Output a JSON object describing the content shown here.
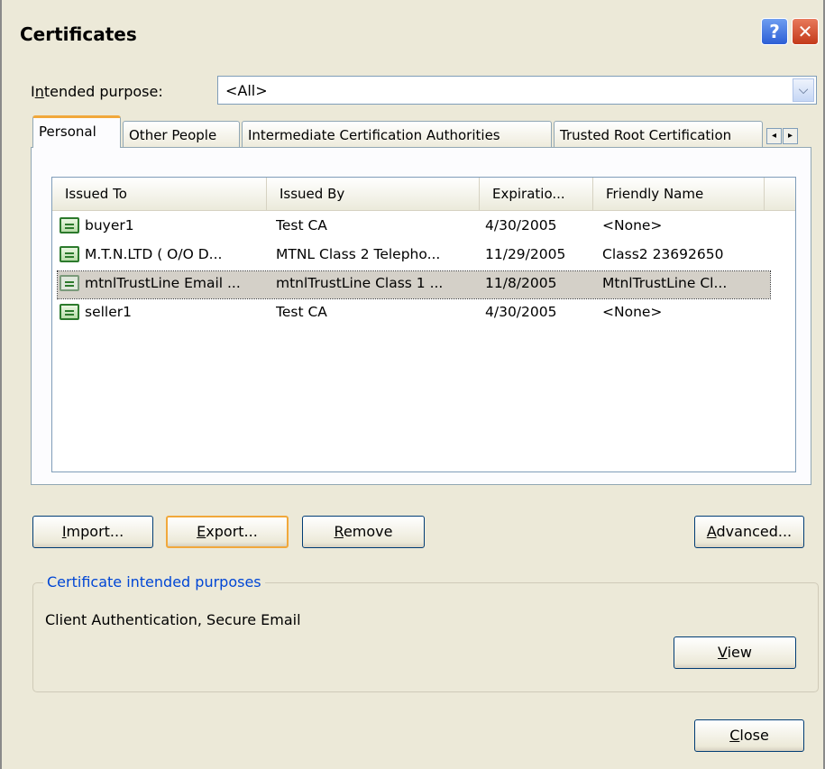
{
  "window": {
    "title": "Certificates",
    "help_glyph": "?",
    "close_glyph": "✕"
  },
  "intended_purpose": {
    "label_prefix": "I",
    "label_accel": "n",
    "label_rest": "tended purpose:",
    "value": "<All>",
    "arrow_icon": "chevron-down-icon"
  },
  "tabs": [
    {
      "label": "Personal",
      "active": true
    },
    {
      "label": "Other People",
      "active": false
    },
    {
      "label": "Intermediate Certification Authorities",
      "active": false
    },
    {
      "label": "Trusted Root Certification",
      "active": false
    }
  ],
  "tab_scroll": {
    "left": "◂",
    "right": "▸"
  },
  "list": {
    "columns": [
      "Issued To",
      "Issued By",
      "Expiratio...",
      "Friendly Name"
    ],
    "rows": [
      {
        "issued_to": "buyer1",
        "issued_by": "Test CA",
        "expiration": "4/30/2005",
        "friendly_name": "<None>",
        "selected": false
      },
      {
        "issued_to": "M.T.N.LTD ( O/O D...",
        "issued_by": "MTNL Class 2 Telepho...",
        "expiration": "11/29/2005",
        "friendly_name": "Class2 23692650",
        "selected": false
      },
      {
        "issued_to": "mtnlTrustLine Email ...",
        "issued_by": "mtnlTrustLine Class 1 ...",
        "expiration": "11/8/2005",
        "friendly_name": "MtnlTrustLine Cl...",
        "selected": true
      },
      {
        "issued_to": "seller1",
        "issued_by": "Test CA",
        "expiration": "4/30/2005",
        "friendly_name": "<None>",
        "selected": false
      }
    ]
  },
  "buttons": {
    "import": {
      "accel": "I",
      "rest": "mport..."
    },
    "export": {
      "accel": "E",
      "rest": "xport..."
    },
    "remove": {
      "accel": "R",
      "rest": "emove"
    },
    "advanced": {
      "accel": "A",
      "rest": "dvanced..."
    },
    "view": {
      "accel": "V",
      "rest": "iew"
    },
    "close": {
      "accel": "C",
      "rest": "lose"
    }
  },
  "purposes_group": {
    "legend": "Certificate intended purposes",
    "text": "Client Authentication, Secure Email"
  },
  "colors": {
    "dialog_bg": "#ece9d8",
    "accent_legend": "#0046d5",
    "focus_orange": "#f1a83b",
    "button_border": "#003c74"
  }
}
